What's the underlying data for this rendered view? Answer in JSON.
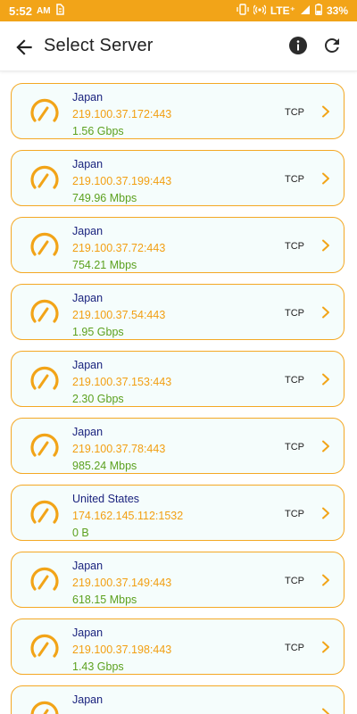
{
  "status_bar": {
    "time": "5:52",
    "ampm": "AM",
    "network": "LTE⁺",
    "battery": "33%"
  },
  "header": {
    "title": "Select Server"
  },
  "colors": {
    "accent": "#f2a418",
    "country": "#1a237e",
    "address": "#f29f12",
    "speed": "#5ca11f",
    "card_bg": "#f5fdfc"
  },
  "servers": [
    {
      "country": "Japan",
      "address": "219.100.37.172:443",
      "speed": "1.56 Gbps",
      "protocol": "TCP"
    },
    {
      "country": "Japan",
      "address": "219.100.37.199:443",
      "speed": "749.96 Mbps",
      "protocol": "TCP"
    },
    {
      "country": "Japan",
      "address": "219.100.37.72:443",
      "speed": "754.21 Mbps",
      "protocol": "TCP"
    },
    {
      "country": "Japan",
      "address": "219.100.37.54:443",
      "speed": "1.95 Gbps",
      "protocol": "TCP"
    },
    {
      "country": "Japan",
      "address": "219.100.37.153:443",
      "speed": "2.30 Gbps",
      "protocol": "TCP"
    },
    {
      "country": "Japan",
      "address": "219.100.37.78:443",
      "speed": "985.24 Mbps",
      "protocol": "TCP"
    },
    {
      "country": "United States",
      "address": "174.162.145.112:1532",
      "speed": "0 B",
      "protocol": "TCP"
    },
    {
      "country": "Japan",
      "address": "219.100.37.149:443",
      "speed": "618.15 Mbps",
      "protocol": "TCP"
    },
    {
      "country": "Japan",
      "address": "219.100.37.198:443",
      "speed": "1.43 Gbps",
      "protocol": "TCP"
    },
    {
      "country": "Japan",
      "address": "",
      "speed": "",
      "protocol": ""
    }
  ]
}
